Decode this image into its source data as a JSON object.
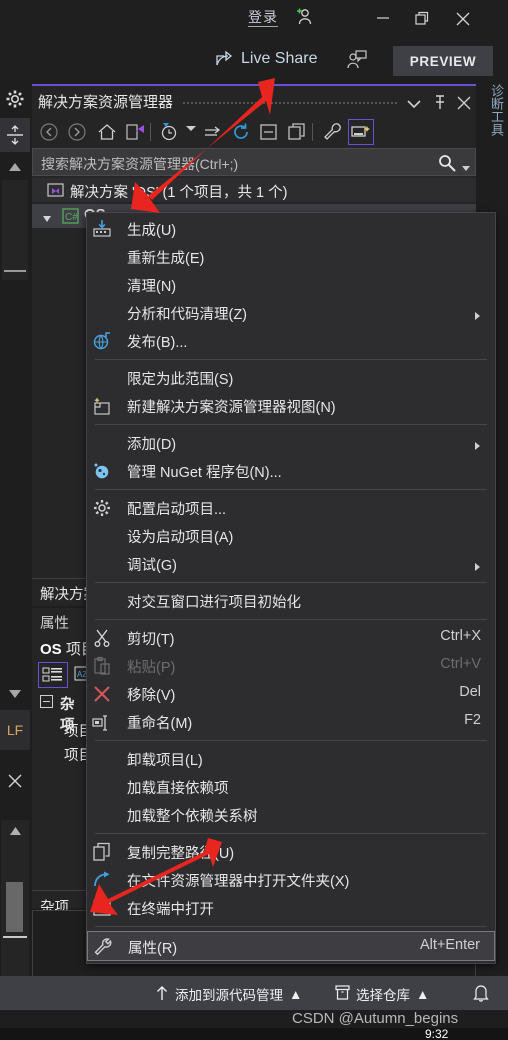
{
  "titlebar": {
    "signin_label": "登录",
    "account_icon": "add-person-icon",
    "minimize_label": "−",
    "maximize_label": "❐",
    "close_label": "✕"
  },
  "secondbar": {
    "live_share_label": "Live Share",
    "live_share_icon": "share-icon",
    "invite_icon": "invite-person-icon",
    "preview_label": "PREVIEW"
  },
  "left_rail": {
    "gear_icon": "gear-icon",
    "split_icon": "split-vertical-icon",
    "scroll_up_icon": "chevron-up-icon",
    "scroll_down_icon": "chevron-down-icon",
    "line_ending_badge": "LF",
    "close_icon": "close-icon"
  },
  "right_rail": {
    "diagnostics_label": "诊断工具"
  },
  "solution_explorer": {
    "title": "解决方案资源管理器",
    "header_buttons": [
      {
        "name": "dropdown-chevron-icon",
        "glyph": "▼"
      },
      {
        "name": "pin-icon",
        "glyph": "📌"
      },
      {
        "name": "close-icon",
        "glyph": "✕"
      }
    ],
    "toolbar": [
      {
        "name": "back-icon"
      },
      {
        "name": "forward-icon"
      },
      {
        "name": "home-icon"
      },
      {
        "name": "vs-pending-changes-icon"
      },
      {
        "name": "pending-changes-filter-icon"
      },
      {
        "name": "sync-views-icon"
      },
      {
        "name": "refresh-icon"
      },
      {
        "name": "collapse-all-icon"
      },
      {
        "name": "show-all-files-icon"
      },
      {
        "name": "properties-wrench-icon"
      },
      {
        "name": "preview-selected-items-icon"
      }
    ],
    "search_placeholder": "搜索解决方案资源管理器(Ctrl+;)",
    "search_icon": "search-icon",
    "search_dropdown_icon": "chevron-down-icon",
    "solution_node": "解决方案 'OS' (1 个项目，共 1 个)",
    "solution_icon": "solution-icon",
    "project_node": "OS",
    "project_icon": "csharp-project-icon",
    "tab_label": "解决方案资源管理器"
  },
  "properties_panel": {
    "title": "属性",
    "subject": "OS 项目属性",
    "subject_bold": "OS",
    "subject_rest": " 项目属性",
    "toolbar": [
      {
        "name": "categorized-view-icon"
      },
      {
        "name": "alphabetical-view-icon"
      }
    ],
    "category": "杂项",
    "rows": [
      {
        "label": "项目文件"
      },
      {
        "label": "项目文件夹"
      }
    ],
    "tab_label": "杂项"
  },
  "context_menu": {
    "items": [
      {
        "id": "build",
        "icon": "build-icon",
        "label": "生成(U)",
        "key": "",
        "submenu": false,
        "disabled": false
      },
      {
        "id": "rebuild",
        "icon": "",
        "label": "重新生成(E)",
        "key": "",
        "submenu": false,
        "disabled": false
      },
      {
        "id": "clean",
        "icon": "",
        "label": "清理(N)",
        "key": "",
        "submenu": false,
        "disabled": false
      },
      {
        "id": "analyze",
        "icon": "",
        "label": "分析和代码清理(Z)",
        "key": "",
        "submenu": true,
        "disabled": false
      },
      {
        "id": "publish",
        "icon": "publish-globe-icon",
        "label": "发布(B)...",
        "key": "",
        "submenu": false,
        "disabled": false
      },
      {
        "id": "sep1",
        "separator": true
      },
      {
        "id": "scope-to-this",
        "icon": "",
        "label": "限定为此范围(S)",
        "key": "",
        "submenu": false,
        "disabled": false
      },
      {
        "id": "new-se-view",
        "icon": "new-view-icon",
        "label": "新建解决方案资源管理器视图(N)",
        "key": "",
        "submenu": false,
        "disabled": false
      },
      {
        "id": "sep2",
        "separator": true
      },
      {
        "id": "add",
        "icon": "",
        "label": "添加(D)",
        "key": "",
        "submenu": true,
        "disabled": false
      },
      {
        "id": "nuget",
        "icon": "nuget-icon",
        "label": "管理 NuGet 程序包(N)...",
        "key": "",
        "submenu": false,
        "disabled": false
      },
      {
        "id": "sep3",
        "separator": true
      },
      {
        "id": "configure-startup",
        "icon": "gear-icon",
        "label": "配置启动项目...",
        "key": "",
        "submenu": false,
        "disabled": false
      },
      {
        "id": "set-startup",
        "icon": "",
        "label": "设为启动项目(A)",
        "key": "",
        "submenu": false,
        "disabled": false
      },
      {
        "id": "debug",
        "icon": "",
        "label": "调试(G)",
        "key": "",
        "submenu": true,
        "disabled": false
      },
      {
        "id": "sep4",
        "separator": true
      },
      {
        "id": "init-interactive",
        "icon": "",
        "label": "对交互窗口进行项目初始化",
        "key": "",
        "submenu": false,
        "disabled": false
      },
      {
        "id": "sep5",
        "separator": true
      },
      {
        "id": "cut",
        "icon": "scissors-icon",
        "label": "剪切(T)",
        "key": "Ctrl+X",
        "submenu": false,
        "disabled": false
      },
      {
        "id": "paste",
        "icon": "clipboard-icon",
        "label": "粘贴(P)",
        "key": "Ctrl+V",
        "submenu": false,
        "disabled": true
      },
      {
        "id": "remove",
        "icon": "x-red-icon",
        "label": "移除(V)",
        "key": "Del",
        "submenu": false,
        "disabled": false
      },
      {
        "id": "rename",
        "icon": "rename-icon",
        "label": "重命名(M)",
        "key": "F2",
        "submenu": false,
        "disabled": false
      },
      {
        "id": "sep6",
        "separator": true
      },
      {
        "id": "unload",
        "icon": "",
        "label": "卸载项目(L)",
        "key": "",
        "submenu": false,
        "disabled": false
      },
      {
        "id": "load-direct",
        "icon": "",
        "label": "加载直接依赖项",
        "key": "",
        "submenu": false,
        "disabled": false
      },
      {
        "id": "load-tree",
        "icon": "",
        "label": "加载整个依赖关系树",
        "key": "",
        "submenu": false,
        "disabled": false
      },
      {
        "id": "sep7",
        "separator": true
      },
      {
        "id": "copy-full-path",
        "icon": "copy-icon",
        "label": "复制完整路径(U)",
        "key": "",
        "submenu": false,
        "disabled": false
      },
      {
        "id": "open-folder",
        "icon": "open-folder-arrow-icon",
        "label": "在文件资源管理器中打开文件夹(X)",
        "key": "",
        "submenu": false,
        "disabled": false
      },
      {
        "id": "open-terminal",
        "icon": "terminal-icon",
        "label": "在终端中打开",
        "key": "",
        "submenu": false,
        "disabled": false
      },
      {
        "id": "sep8",
        "separator": true
      },
      {
        "id": "properties",
        "icon": "wrench-icon",
        "label": "属性(R)",
        "key": "Alt+Enter",
        "submenu": false,
        "disabled": false,
        "highlight": true
      }
    ]
  },
  "status_bar": {
    "add_to_source_control": "添加到源代码管理",
    "add_to_source_control_icon": "arrow-up-icon",
    "add_caret": "▲",
    "select_repo": "选择仓库",
    "select_repo_icon": "repo-icon",
    "repo_caret": "▲",
    "bell_icon": "bell-icon"
  },
  "watermark": "CSDN @Autumn_begins",
  "clock": "9:32",
  "colors": {
    "accent_purple": "#6b4fd8",
    "panel_bg": "#252526",
    "menu_bg": "#2d2d30",
    "status_bg": "#3f3f46",
    "arrow_red": "#e8251f",
    "link_blue": "#3f9fe0",
    "lf_orange": "#d7a45e"
  }
}
